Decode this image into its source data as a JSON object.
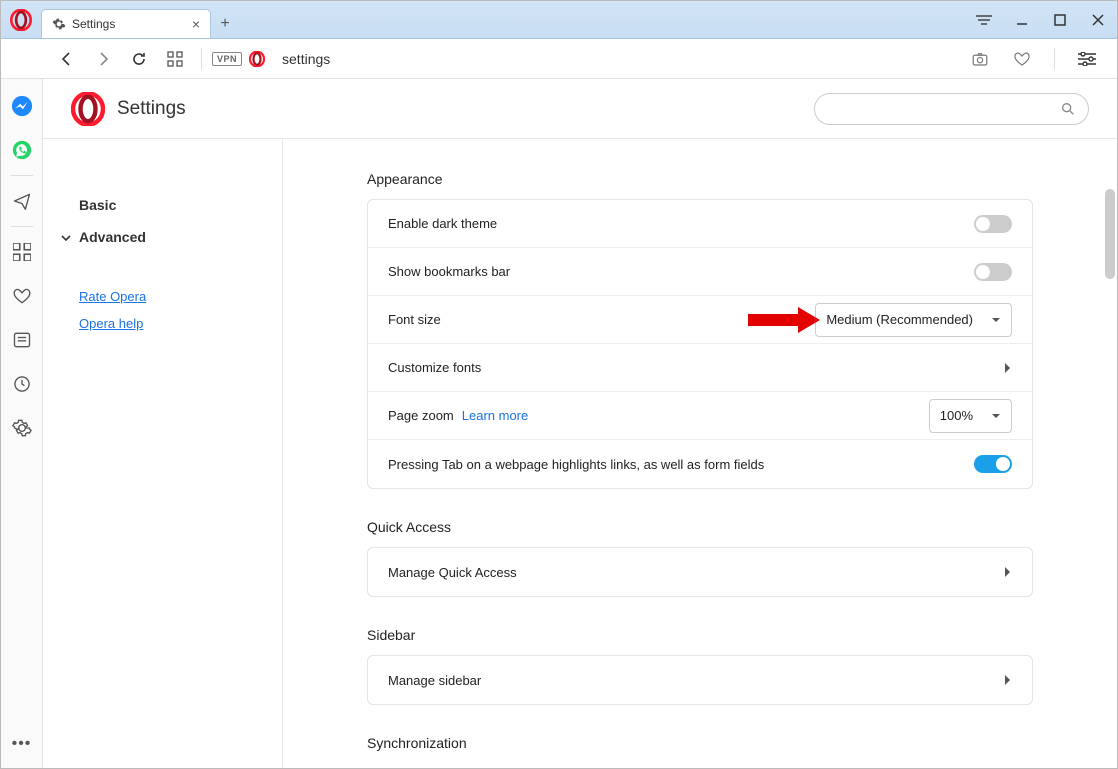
{
  "window": {
    "tab_title": "Settings",
    "address_bar": "settings",
    "vpn_label": "VPN"
  },
  "header": {
    "page_title": "Settings"
  },
  "nav": {
    "basic": "Basic",
    "advanced": "Advanced",
    "rate_opera": "Rate Opera",
    "opera_help": "Opera help"
  },
  "sections": {
    "appearance": {
      "title": "Appearance",
      "dark_theme": "Enable dark theme",
      "bookmarks_bar": "Show bookmarks bar",
      "font_size": "Font size",
      "font_size_value": "Medium (Recommended)",
      "customize_fonts": "Customize fonts",
      "page_zoom": "Page zoom",
      "learn_more": "Learn more",
      "page_zoom_value": "100%",
      "tab_highlights": "Pressing Tab on a webpage highlights links, as well as form fields"
    },
    "quick_access": {
      "title": "Quick Access",
      "manage": "Manage Quick Access"
    },
    "sidebar": {
      "title": "Sidebar",
      "manage": "Manage sidebar"
    },
    "sync": {
      "title": "Synchronization"
    }
  },
  "colors": {
    "accent": "#1a9fe8",
    "link": "#1a73e8",
    "opera_red": "#ff1b2d"
  }
}
